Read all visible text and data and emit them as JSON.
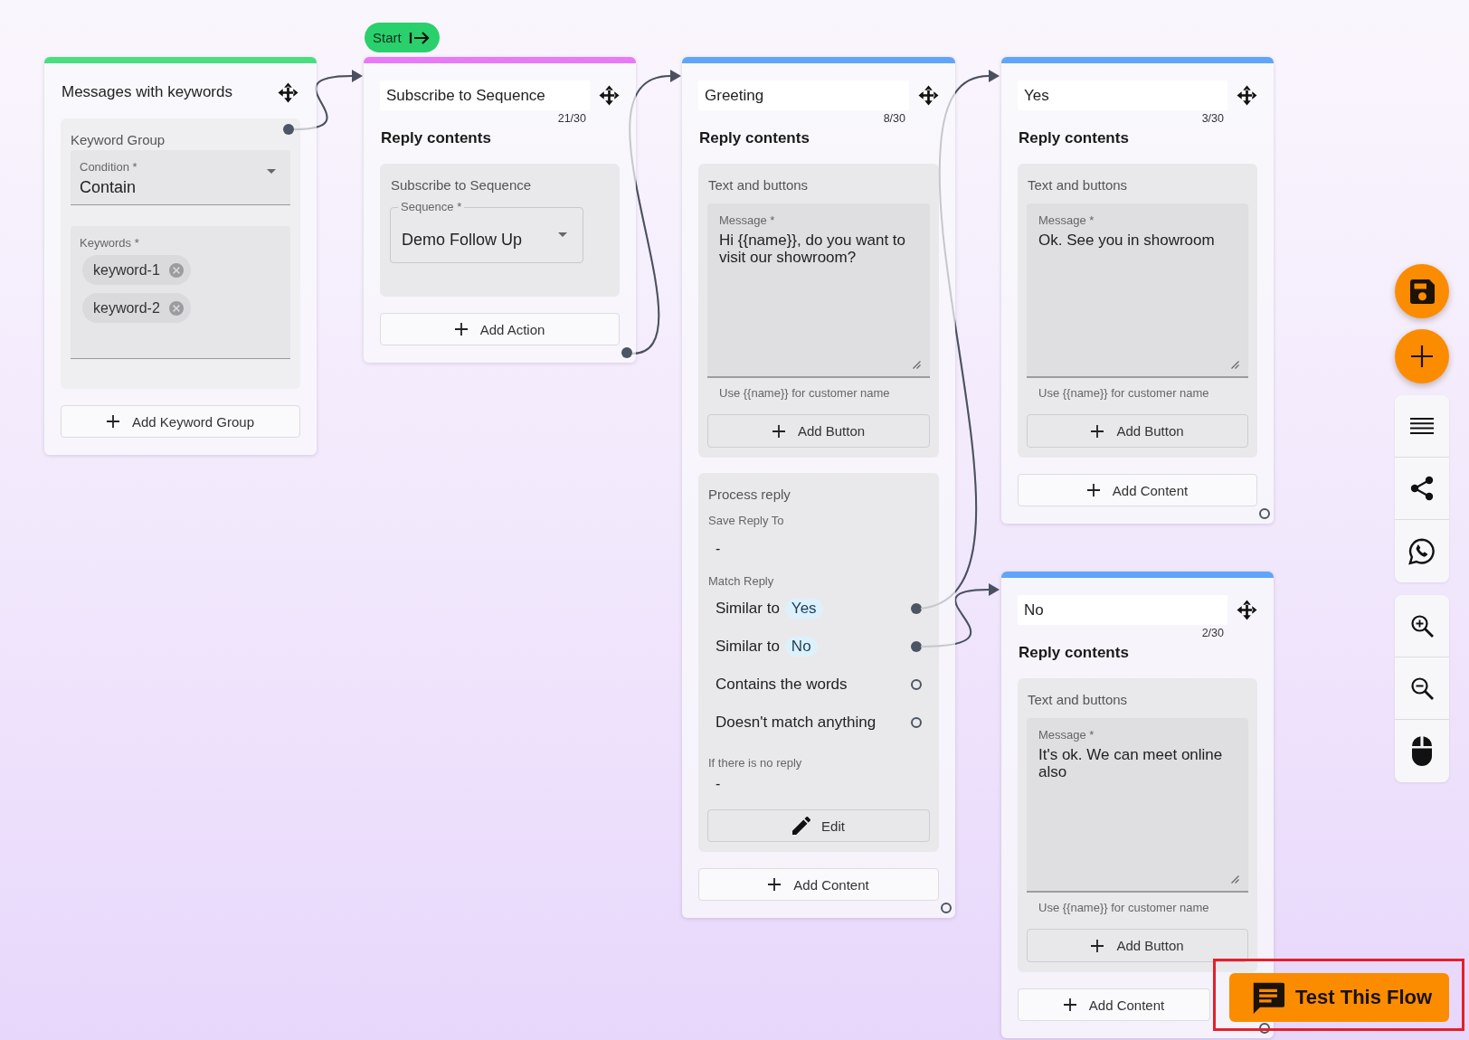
{
  "start_badge": {
    "label": "Start"
  },
  "nodes": [
    {
      "kind": "trigger",
      "color": "#4ade80",
      "title": "Messages with keywords",
      "keyword_group": {
        "heading": "Keyword Group",
        "connected": true,
        "condition": {
          "label": "Condition *",
          "value": "Contain"
        },
        "keywords": {
          "label": "Keywords *",
          "chips": [
            "keyword-1",
            "keyword-2"
          ]
        }
      },
      "add_label": "Add Keyword Group"
    },
    {
      "kind": "action",
      "color": "#e879f9",
      "title": "Subscribe to Sequence",
      "counter": "21/30",
      "section_title": "Reply contents",
      "blocks": [
        {
          "kind": "subscribe",
          "heading": "Subscribe to Sequence",
          "field_label": "Sequence *",
          "value": "Demo Follow Up"
        }
      ],
      "add_label": "Add Action",
      "output_connected": true
    },
    {
      "kind": "message",
      "color": "#60a5fa",
      "title": "Greeting",
      "counter": "8/30",
      "section_title": "Reply contents",
      "blocks": [
        {
          "kind": "text",
          "heading": "Text and buttons",
          "field_label": "Message *",
          "value": "Hi {{name}}, do you want to visit our showroom?",
          "hint": "Use {{name}} for customer name",
          "button_label": "Add Button"
        },
        {
          "kind": "process_reply",
          "heading": "Process reply",
          "save_label": "Save Reply To",
          "save_value": "-",
          "match_label": "Match Reply",
          "matches": [
            {
              "text": "Similar to",
              "tag": "Yes",
              "connected": true
            },
            {
              "text": "Similar to",
              "tag": "No",
              "connected": true
            },
            {
              "text": "Contains the words",
              "connected": false
            },
            {
              "text": "Doesn't match anything",
              "connected": false
            }
          ],
          "no_reply_label": "If there is no reply",
          "no_reply_value": "-",
          "button_label": "Edit"
        }
      ],
      "add_label": "Add Content",
      "output_connected": false
    },
    {
      "kind": "message",
      "color": "#60a5fa",
      "title": "Yes",
      "counter": "3/30",
      "section_title": "Reply contents",
      "blocks": [
        {
          "kind": "text",
          "heading": "Text and buttons",
          "field_label": "Message *",
          "value": "Ok. See you in showroom",
          "hint": "Use {{name}} for customer name",
          "button_label": "Add Button"
        }
      ],
      "add_label": "Add Content",
      "output_connected": false
    },
    {
      "kind": "message",
      "color": "#60a5fa",
      "title": "No",
      "counter": "2/30",
      "section_title": "Reply contents",
      "blocks": [
        {
          "kind": "text",
          "heading": "Text and buttons",
          "field_label": "Message *",
          "value": "It's ok. We can meet online also",
          "hint": "Use {{name}} for customer name",
          "button_label": "Add Button"
        }
      ],
      "add_label": "Add Content",
      "output_connected": false
    }
  ],
  "test_button": {
    "label": "Test This Flow",
    "highlighted": true
  }
}
